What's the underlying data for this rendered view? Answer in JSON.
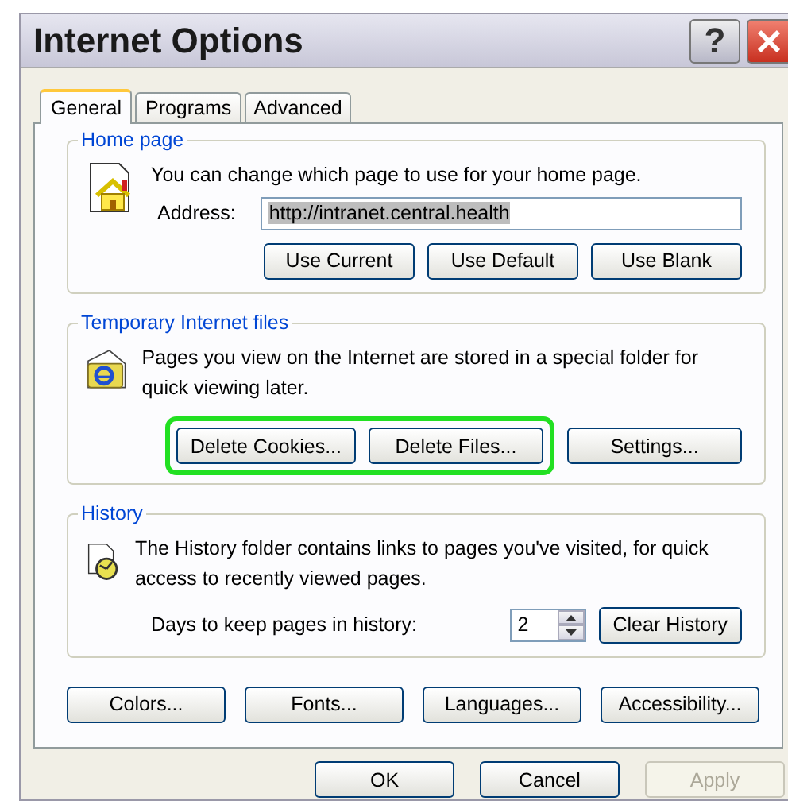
{
  "window": {
    "title": "Internet Options",
    "title_buttons": [
      {
        "kind": "help",
        "label": "?"
      },
      {
        "kind": "close"
      }
    ]
  },
  "tabs": [
    {
      "label": "General",
      "selected": true
    },
    {
      "label": "Programs",
      "selected": false
    },
    {
      "label": "Advanced",
      "selected": false
    }
  ],
  "home_page": {
    "title": "Home page",
    "description": "You can change which page to use for your home page.",
    "address_label": "Address:",
    "address_value": "http://intranet.central.health",
    "address_selected": true,
    "buttons": [
      {
        "label": "Use Current"
      },
      {
        "label": "Use Default"
      },
      {
        "label": "Use Blank"
      }
    ]
  },
  "temporary_files": {
    "title": "Temporary Internet files",
    "description": "Pages you view on the Internet are stored in a special folder for quick viewing later.",
    "button_groups": [
      {
        "highlighted": true,
        "buttons": [
          {
            "label": "Delete Cookies..."
          },
          {
            "label": "Delete Files..."
          }
        ]
      },
      {
        "highlighted": false,
        "buttons": [
          {
            "label": "Settings..."
          }
        ]
      }
    ]
  },
  "history": {
    "title": "History",
    "description": "The History folder contains links to pages you've visited, for quick access to recently viewed pages.",
    "days_label": "Days to keep pages in history:",
    "days_value": "2",
    "buttons": [
      {
        "label": "Clear History"
      }
    ]
  },
  "bottom_buttons": [
    {
      "label": "Colors..."
    },
    {
      "label": "Fonts..."
    },
    {
      "label": "Languages..."
    },
    {
      "label": "Accessibility..."
    }
  ],
  "dialog_buttons": [
    {
      "label": "OK",
      "disabled": false
    },
    {
      "label": "Cancel",
      "disabled": false
    },
    {
      "label": "Apply",
      "disabled": true
    }
  ]
}
